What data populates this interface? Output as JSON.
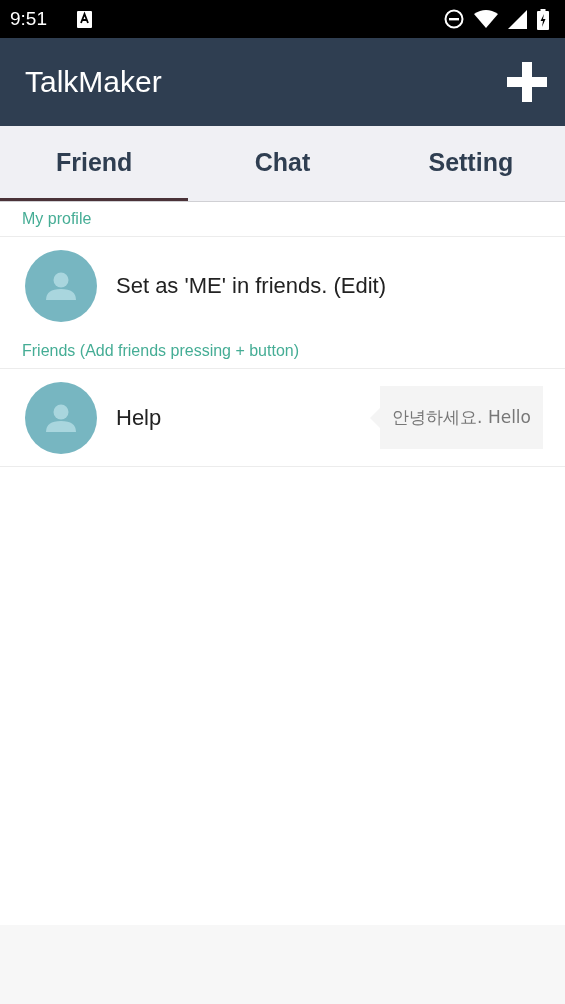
{
  "status_bar": {
    "time": "9:51"
  },
  "app_bar": {
    "title": "TalkMaker"
  },
  "tabs": [
    {
      "label": "Friend",
      "selected": true
    },
    {
      "label": "Chat",
      "selected": false
    },
    {
      "label": "Setting",
      "selected": false
    }
  ],
  "my_profile": {
    "header": "My profile",
    "name": "Set as 'ME' in friends. (Edit)"
  },
  "friends": {
    "header": "Friends (Add friends pressing + button)",
    "items": [
      {
        "name": "Help",
        "message": "안녕하세요. Hello"
      }
    ]
  }
}
